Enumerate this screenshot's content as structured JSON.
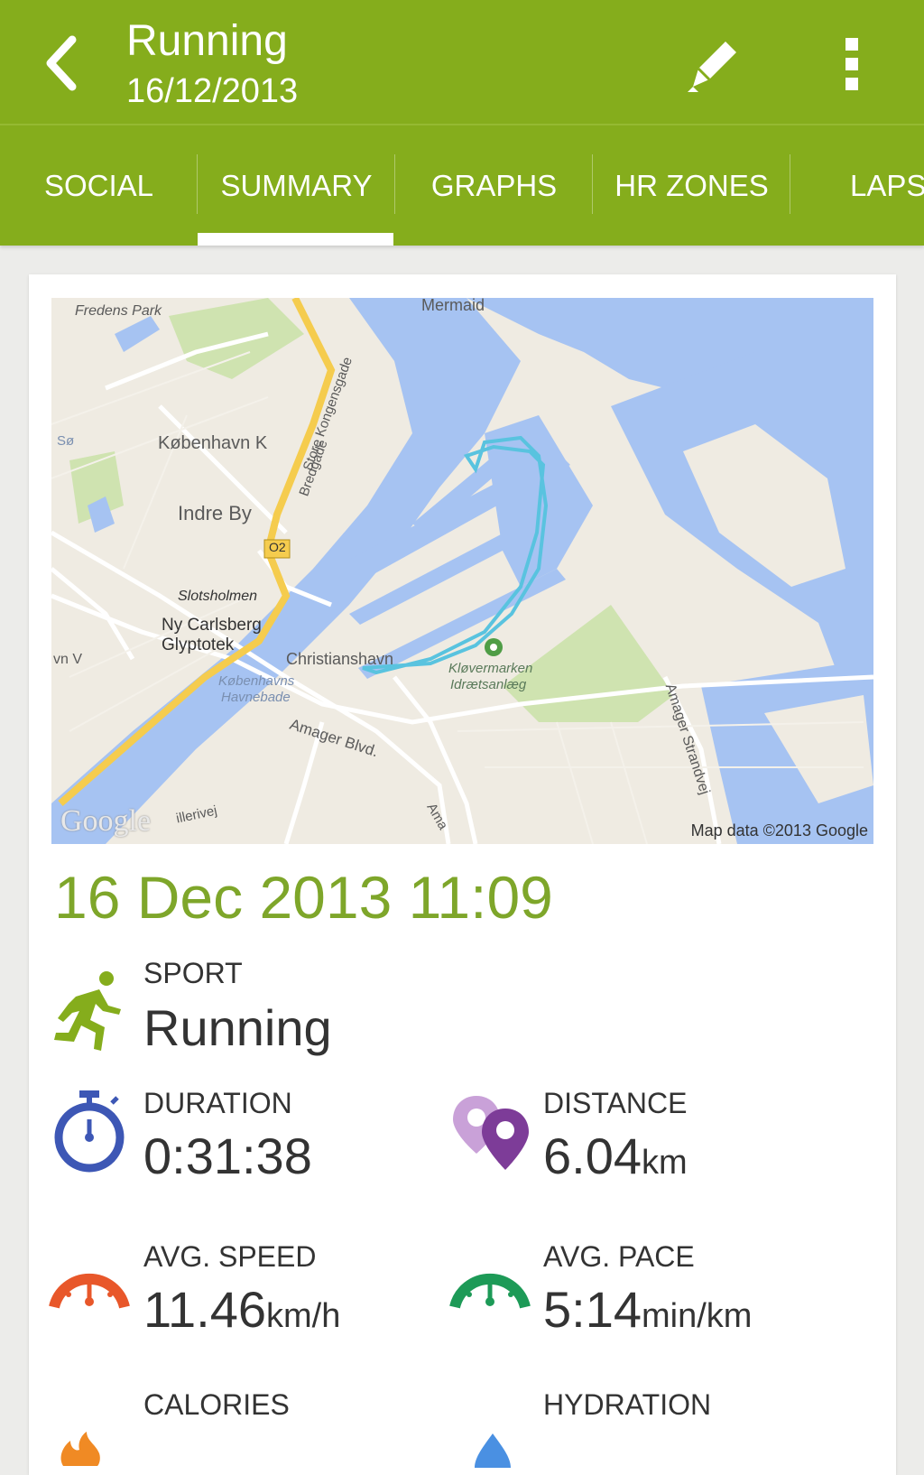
{
  "header": {
    "title": "Running",
    "subtitle": "16/12/2013"
  },
  "tabs": [
    "SOCIAL",
    "SUMMARY",
    "GRAPHS",
    "HR ZONES",
    "LAPS"
  ],
  "active_tab": "SUMMARY",
  "map": {
    "labels": {
      "fredens_park": "Fredens Park",
      "mermaid": "Mermaid",
      "koebenhavn_k": "København K",
      "indre_by": "Indre By",
      "store_kongensgade": "Store Kongensgade",
      "bredgade": "Bredgade",
      "road_o2": "O2",
      "slotsholmen": "Slotsholmen",
      "ny_carlsberg": "Ny Carlsberg",
      "glyptotek": "Glyptotek",
      "christianshavn": "Christianshavn",
      "havnebade_1": "Københavns",
      "havnebade_2": "Havnebade",
      "kloevermarken_1": "Kløvermarken",
      "kloevermarken_2": "Idrætsanlæg",
      "amager_blvd": "Amager Blvd.",
      "amager_strandvej": "Amager Strandvej",
      "soe": "Sø",
      "vn_v": "vn V",
      "illerivej": "illerivej",
      "ama": "Ama"
    },
    "logo": "Google",
    "attribution": "Map data ©2013 Google"
  },
  "workout": {
    "datetime": "16 Dec 2013 11:09",
    "sport_label": "SPORT",
    "sport_value": "Running",
    "duration_label": "DURATION",
    "duration_value": "0:31:38",
    "distance_label": "DISTANCE",
    "distance_value": "6.04",
    "distance_unit": "km",
    "avg_speed_label": "AVG. SPEED",
    "avg_speed_value": "11.46",
    "avg_speed_unit": "km/h",
    "avg_pace_label": "AVG. PACE",
    "avg_pace_value": "5:14",
    "avg_pace_unit": "min/km",
    "calories_label": "CALORIES",
    "hydration_label": "HYDRATION"
  },
  "colors": {
    "brand_green": "#85ad1c",
    "date_green": "#7ea62a",
    "duration_blue": "#3d57b5",
    "distance_purple": "#7d3c98",
    "speed_orange": "#e8572a",
    "pace_green": "#1d9a57"
  },
  "icons": {
    "back": "back-arrow-icon",
    "edit": "pencil-icon",
    "more": "overflow-menu-icon",
    "sport": "running-person-icon",
    "duration": "stopwatch-icon",
    "distance": "map-pins-icon",
    "speed": "speedometer-icon",
    "pace": "gauge-icon",
    "calories": "flame-icon",
    "hydration": "water-drop-icon"
  }
}
